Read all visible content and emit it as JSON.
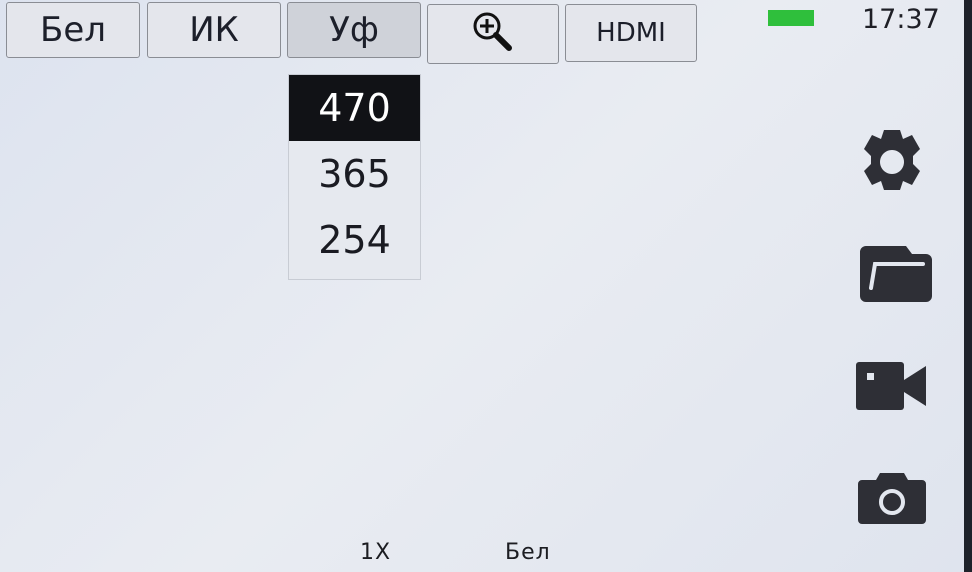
{
  "tabs": [
    {
      "label": "Бел",
      "active": false
    },
    {
      "label": "ИК",
      "active": false
    },
    {
      "label": "Уф",
      "active": true
    },
    {
      "icon": "zoom-in-icon"
    },
    {
      "label": "HDMI",
      "active": false
    }
  ],
  "status_bar": {
    "time": "17:37",
    "battery_color": "#2fbf3c"
  },
  "wavelength_dropdown": {
    "options": [
      "470",
      "365",
      "254"
    ],
    "selected": "470"
  },
  "side_icons": [
    "gear-icon",
    "folder-icon",
    "video-camera-icon",
    "camera-icon"
  ],
  "bottom_status": {
    "zoom": "1X",
    "mode": "Бел"
  }
}
